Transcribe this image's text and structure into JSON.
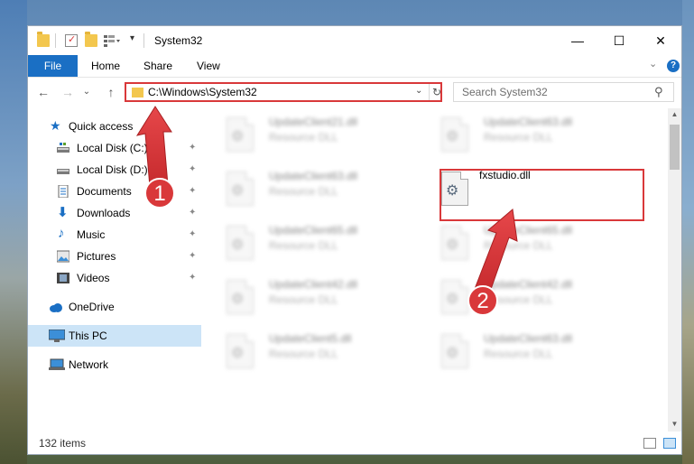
{
  "window": {
    "title": "System32",
    "minimize_glyph": "—",
    "maximize_glyph": "☐",
    "close_glyph": "✕"
  },
  "ribbon": {
    "tabs": [
      {
        "label": "File"
      },
      {
        "label": "Home"
      },
      {
        "label": "Share"
      },
      {
        "label": "View"
      }
    ],
    "help_glyph": "?",
    "collapse_glyph": "⌄"
  },
  "navigation": {
    "back_glyph": "←",
    "forward_glyph": "→",
    "recent_glyph": "⌄",
    "up_glyph": "↑",
    "address": "C:\\Windows\\System32",
    "address_dropdown_glyph": "⌄",
    "refresh_glyph": "↻",
    "search_placeholder": "Search System32",
    "search_glyph": "⚲"
  },
  "sidebar": {
    "items": [
      {
        "label": "Quick access",
        "icon": "star-icon",
        "pinned": false
      },
      {
        "label": "Local Disk (C:)",
        "icon": "drive-icon",
        "pinned": true
      },
      {
        "label": "Local Disk (D:)",
        "icon": "drive-icon",
        "pinned": true
      },
      {
        "label": "Documents",
        "icon": "document-icon",
        "pinned": true
      },
      {
        "label": "Downloads",
        "icon": "download-icon",
        "pinned": true
      },
      {
        "label": "Music",
        "icon": "music-icon",
        "pinned": true
      },
      {
        "label": "Pictures",
        "icon": "pictures-icon",
        "pinned": true
      },
      {
        "label": "Videos",
        "icon": "videos-icon",
        "pinned": true
      },
      {
        "label": "OneDrive",
        "icon": "cloud-icon",
        "pinned": false
      },
      {
        "label": "This PC",
        "icon": "computer-icon",
        "pinned": false,
        "selected": true
      },
      {
        "label": "Network",
        "icon": "network-icon",
        "pinned": false
      }
    ],
    "pin_glyph": "📌"
  },
  "files": [
    {
      "name": "UpdateClient21.dll",
      "type": "Resource DLL",
      "blurred": true
    },
    {
      "name": "UpdateClient63.dll",
      "type": "Resource DLL",
      "blurred": true
    },
    {
      "name": "UpdateClient63.dll",
      "type": "Resource DLL",
      "blurred": true
    },
    {
      "name": "fxstudio.dll",
      "type": "",
      "blurred": false
    },
    {
      "name": "UpdateClient65.dll",
      "type": "Resource DLL",
      "blurred": true
    },
    {
      "name": "UpdateClient65.dll",
      "type": "Resource DLL",
      "blurred": true
    },
    {
      "name": "UpdateClient42.dll",
      "type": "Resource DLL",
      "blurred": true
    },
    {
      "name": "UpdateClient42.dll",
      "type": "Resource DLL",
      "blurred": true
    },
    {
      "name": "UpdateClient5.dll",
      "type": "Resource DLL",
      "blurred": true
    },
    {
      "name": "UpdateClient63.dll",
      "type": "Resource DLL",
      "blurred": true
    }
  ],
  "status": {
    "item_count": "132 items"
  },
  "annotations": {
    "marker_1": "1",
    "marker_2": "2",
    "color": "#d9383a"
  }
}
